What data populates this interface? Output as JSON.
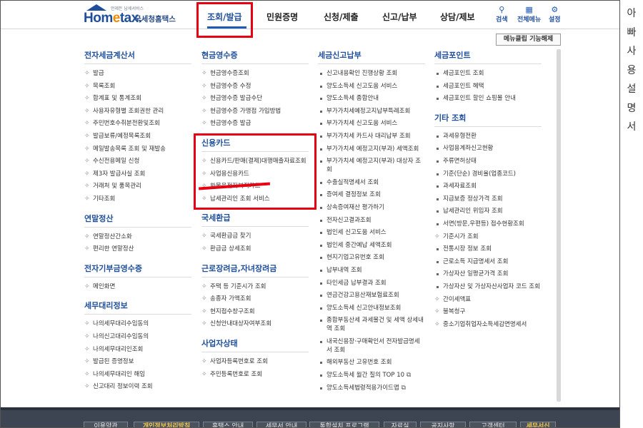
{
  "logo": {
    "tagline": "언제든 납세서비스",
    "name_a": "Hom",
    "name_e": "e",
    "name_b": "tax.",
    "subtitle": "국세청홈택스"
  },
  "nav": {
    "items": [
      "조회/발급",
      "민원증명",
      "신청/제출",
      "신고/납부",
      "상담/제보"
    ],
    "active": "조회/발급"
  },
  "tools": {
    "search": "검색",
    "all_menu": "전체메뉴",
    "settings": "설정"
  },
  "menu_clip_button": "메뉴클립 기능해제",
  "side_text": [
    "아",
    "빠",
    "사",
    "용",
    "설",
    "명",
    "서"
  ],
  "columns": [
    {
      "sections": [
        {
          "title": "전자세금계산서",
          "bullet": "cross",
          "items": [
            "발급",
            "목록조회",
            "합계표 및 통계조회",
            "사용자유형별 조회권한 관리",
            "주민번호수취분전환및조회",
            "발급보류/예정목록조회",
            "메일발송목록 조회 및 재발송",
            "수신전용메일 신청",
            "제3자 발급사실 조회",
            "거래처 및 품목관리",
            "기타조회"
          ]
        },
        {
          "title": "연말정산",
          "bullet": "cross",
          "items": [
            "연말정산간소화",
            "편리한 연말정산"
          ]
        },
        {
          "title": "전자기부금영수증",
          "bullet": "cross",
          "items": [
            "메인화면"
          ]
        },
        {
          "title": "세무대리정보",
          "bullet": "cross",
          "items": [
            "나의세무대리수임동의",
            "나의신고대리수임동의",
            "나의세무대리인조회",
            "발급된 증명정보",
            "나의세무대리인 해임",
            "신고대리 정보이력 조회"
          ]
        }
      ]
    },
    {
      "sections": [
        {
          "title": "현금영수증",
          "bullet": "cross",
          "items": [
            "현금영수증조회",
            "현금영수증 수정",
            "현금영수증 발급수단",
            "현금영수증 가맹점 가입방법",
            "현금영수증 발급"
          ]
        },
        {
          "title": "신용카드",
          "bullet": "cross",
          "items": [
            "신용카드/판매(결제)대행매출자료조회",
            "사업용신용카드",
            "화물운전자복지카드",
            "납세관리인 조회 서비스"
          ]
        },
        {
          "title": "국세환급",
          "bullet": "cross",
          "items": [
            "국세환급금 찾기",
            "환급금 상세조회"
          ]
        },
        {
          "title": "근로장려금,자녀장려금",
          "bullet": "cross",
          "items": [
            "주택 등 기준시가 조회",
            "송종자 가액조회",
            "현지접수창구조회",
            "신청안내대상자여부조회"
          ]
        },
        {
          "title": "사업자상태",
          "bullet": "cross",
          "items": [
            "사업자등록번호로 조회",
            "주민등록번호로 조회"
          ]
        }
      ]
    },
    {
      "sections": [
        {
          "title": "세금신고납부",
          "bullet": "dot",
          "items": [
            "신고내용확인 진행상황 조회",
            "양도소득세 신고도움 서비스",
            "양도소득세 종합안내",
            "부가가치세예정고지납부특례조회",
            "부가가치세 신고도움 서비스",
            "부가가치세 카드사 대리납부 조회",
            "부가가치세 예정고지(부과) 세액조회",
            "부가가치세 예정고지(부과) 대상자 조회",
            "수출실적명세서 조회",
            "증여세 결정정보 조회",
            "상속증여재산 평가하기",
            "전자신고결과조회",
            "법인세 신고도움 서비스",
            "법인세 중간예납 세액조회",
            "현지기업고유번호 조회",
            "납부내역 조회",
            "타인세금 납부결과 조회",
            "연금건강고용산재보험료조회",
            "양도소득세 신고안내정보조회",
            "종합부동산세 과세물건 및 세액 상세내역 조회",
            "내국신용장·구매확인서 전자발급명세서 조회",
            "해외부동산 고유번호 조회",
            "양도소득세 월간 질의 TOP 10",
            "양도소득세법령적용가이드맵"
          ]
        }
      ]
    },
    {
      "sections": [
        {
          "title": "세금포인트",
          "bullet": "dot",
          "items": [
            "세금포인트 조회",
            "세금포인트 혜택",
            "세금포인트 할인 쇼핑몰 안내"
          ]
        },
        {
          "title": "기타 조회",
          "bullet": "mixed",
          "items": [
            "과세유형전환",
            "사업용계좌신고현황",
            "주류면허상태",
            "기준(단순) 경비율(업종코드)",
            "과세자료조회",
            "지급보증 정상가격 조회",
            "납세관리인 위임자 조회",
            "서면(방문,우편등) 접수현황조회",
            "기준시가 조회",
            "전통시장 정보 조회",
            "근로소득 지급명세서 조회",
            "가상자산 일평균가격 조회",
            "가상자산 및 가상자산사업자 코드 조회",
            "간이세액표",
            "불복청구",
            "중소기업취업자소득세감면명세서"
          ]
        }
      ]
    }
  ],
  "footer": {
    "items": [
      "이용약관",
      "개인정보처리방침",
      "홈택스 안내",
      "세무서 안내",
      "통합설치 프로그램",
      "자료실",
      "공지사항",
      "고객센터",
      "세무서신"
    ]
  }
}
